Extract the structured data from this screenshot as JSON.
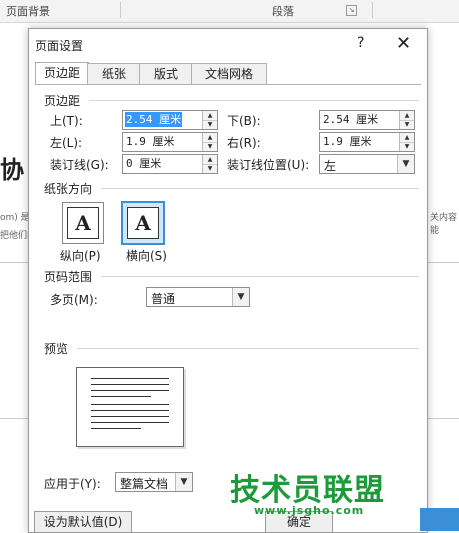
{
  "background": {
    "ribbon": {
      "group_page_background": "页面背景",
      "group_paragraph": "段落"
    },
    "doc_heading_fragment": "协",
    "doc_snippet_1": "om) 是",
    "doc_snippet_2": "把他们的",
    "doc_snippet_right": "关内容能"
  },
  "dialog": {
    "title": "页面设置",
    "help_symbol": "?",
    "close_symbol": "✕",
    "tabs": [
      {
        "label": "页边距",
        "active": true
      },
      {
        "label": "纸张",
        "active": false
      },
      {
        "label": "版式",
        "active": false
      },
      {
        "label": "文档网格",
        "active": false
      }
    ],
    "margins": {
      "section_title": "页边距",
      "top_label": "上(T):",
      "top_value": "2.54 厘米",
      "bottom_label": "下(B):",
      "bottom_value": "2.54 厘米",
      "left_label": "左(L):",
      "left_value": "1.9 厘米",
      "right_label": "右(R):",
      "right_value": "1.9 厘米",
      "gutter_label": "装订线(G):",
      "gutter_value": "0 厘米",
      "gutter_pos_label": "装订线位置(U):",
      "gutter_pos_value": "左"
    },
    "orientation": {
      "section_title": "纸张方向",
      "portrait_label": "纵向(P)",
      "landscape_label": "横向(S)",
      "glyph": "A",
      "selected": "landscape"
    },
    "pages": {
      "section_title": "页码范围",
      "multiple_label": "多页(M):",
      "multiple_value": "普通"
    },
    "preview": {
      "section_title": "预览"
    },
    "apply_to": {
      "label": "应用于(Y):",
      "value": "整篇文档"
    },
    "set_default_label": "设为默认值(D)",
    "ok_fragment": "确定"
  },
  "watermark": {
    "text": "技术员联盟",
    "url": "www.jsgho.com"
  },
  "colors": {
    "accent": "#3b8fd6",
    "selection": "#3399ff",
    "watermark": "#1d9a3a"
  }
}
